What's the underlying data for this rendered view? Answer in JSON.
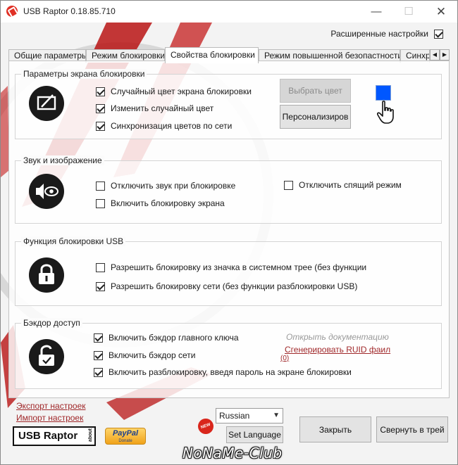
{
  "window": {
    "title": "USB Raptor 0.18.85.710",
    "minimize": "—",
    "maximize": "☐",
    "close": "✕"
  },
  "advanced": {
    "label": "Расширенные настройки",
    "checked": true
  },
  "tabs": [
    {
      "label": "Общие параметры",
      "active": false
    },
    {
      "label": "Режим блокировки",
      "active": false
    },
    {
      "label": "Свойства блокировки",
      "active": true
    },
    {
      "label": "Режим повышенной безопастности",
      "active": false
    },
    {
      "label": "Синхро",
      "active": false
    }
  ],
  "tab_scroll": {
    "left": "◀",
    "right": "▶"
  },
  "lock_screen": {
    "title": "Параметры экрана блокировки",
    "icon": "pen-monitor-icon",
    "options": [
      {
        "label": "Случайный цвет экрана блокировки",
        "checked": true
      },
      {
        "label": "Изменить случайный цвет",
        "checked": true
      },
      {
        "label": "Синхронизация цветов по сети",
        "checked": true
      }
    ],
    "choose_color": "Выбрать цвет",
    "customize": "Персонализиров",
    "swatch_color": "#0057ff",
    "cursor_icon": "hand-pointer-icon"
  },
  "sound": {
    "title": "Звук и изображение",
    "icon": "speaker-eye-icon",
    "options": [
      {
        "label": "Отключить звук при блокировке",
        "checked": false
      },
      {
        "label": "Включить блокировку экрана",
        "checked": false
      }
    ],
    "sleep": {
      "label": "Отключить спящий режим",
      "checked": false
    }
  },
  "usb_lock": {
    "title": "Функция блокировки USB",
    "icon": "padlock-icon",
    "options": [
      {
        "label": "Разрешить блокировку из значка в системном трее (без функции",
        "checked": false
      },
      {
        "label": "Разрешить блокировку сети (без функции разблокировки USB)",
        "checked": true
      }
    ]
  },
  "backdoor": {
    "title": "Бэкдор доступ",
    "icon": "open-padlock-icon",
    "options": [
      {
        "label": "Включить бэкдор главного ключа",
        "checked": true
      },
      {
        "label": "Включить бэкдор сети",
        "checked": true
      },
      {
        "label": "Включить разблокировку, введя пароль на экране блокировки",
        "checked": true
      }
    ],
    "open_docs": "Открыть документацию",
    "gen_ruid": "Сгенерировать RUID фаил",
    "gen_ruid_count": "(0)"
  },
  "footer": {
    "export": "Экспорт настроек",
    "import": "Импорт настроек",
    "logo_text": "USB Raptor",
    "logo_about": "about",
    "paypal": "PayPal",
    "paypal_sub": "Donate",
    "new_badge": "NEW",
    "language": "Russian",
    "set_language": "Set Language",
    "close": "Закрыть",
    "minimize_tray": "Свернуть в трей"
  },
  "watermark": "NoNaMe-Club"
}
